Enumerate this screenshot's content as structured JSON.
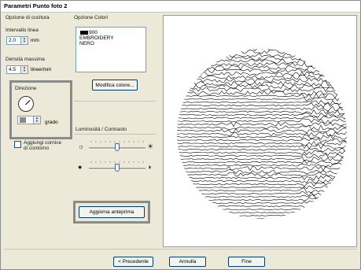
{
  "window": {
    "title": "Parametri Punto foto 2"
  },
  "stitch_options": {
    "group_label": "Opzione di cucitura",
    "interval_label": "Intervallo linea",
    "interval_value": "2.0",
    "interval_unit": "mm",
    "density_label": "Densità massima",
    "density_value": "4.5",
    "density_unit": "linee/mm",
    "direction_label": "Direzione",
    "direction_value": "",
    "direction_unit": "grado",
    "border_checkbox_label": "Aggiungi cornice\ndi contorno"
  },
  "color_options": {
    "group_label": "Opzione Colori",
    "list_lines": "900\nEMBROIDERY\nNERO",
    "swatch_color": "#000000",
    "modify_button": "Modifica colore..."
  },
  "brightness": {
    "group_label": "Luminosità / Contrasto",
    "brightness_level": 0.5,
    "contrast_level": 0.5
  },
  "preview_button": "Aggiorna anteprima",
  "footer": {
    "back_button": "< Precedente",
    "cancel_button": "Annulla",
    "finish_button": "Fine"
  }
}
